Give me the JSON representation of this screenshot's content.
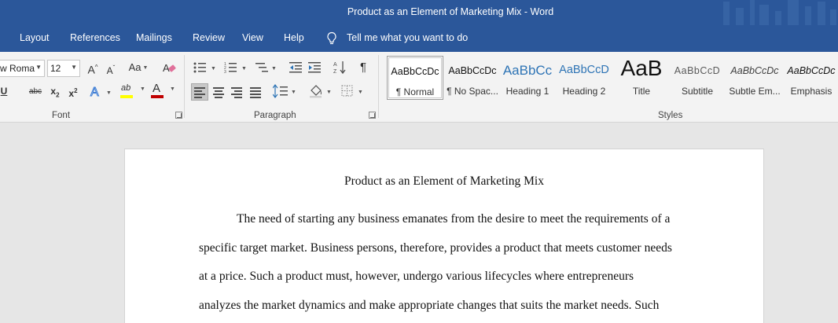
{
  "window": {
    "title": "Product as an Element of Marketing Mix  -  Word"
  },
  "menu": {
    "tabs": [
      "Layout",
      "References",
      "Mailings",
      "Review",
      "View",
      "Help"
    ],
    "tell_me": "Tell me what you want to do"
  },
  "ribbon": {
    "font": {
      "group_label": "Font",
      "font_name": "w Roma",
      "font_size": "12",
      "grow": "A",
      "shrink": "A",
      "change_case": "Aa",
      "strikethrough": "abc",
      "subscript": "x",
      "superscript": "x",
      "underline": "U",
      "highlight_label": "ab",
      "font_color_label": "A",
      "highlight_color": "#ffff00",
      "font_color": "#c00000"
    },
    "paragraph": {
      "group_label": "Paragraph",
      "pilcrow": "¶"
    },
    "styles": {
      "group_label": "Styles",
      "items": [
        {
          "sample": "AaBbCcDc",
          "name": "¶ Normal"
        },
        {
          "sample": "AaBbCcDc",
          "name": "¶ No Spac..."
        },
        {
          "sample": "AaBbCc",
          "name": "Heading 1"
        },
        {
          "sample": "AaBbCcD",
          "name": "Heading 2"
        },
        {
          "sample": "AaB",
          "name": "Title"
        },
        {
          "sample": "AaBbCcD",
          "name": "Subtitle"
        },
        {
          "sample": "AaBbCcDc",
          "name": "Subtle Em..."
        },
        {
          "sample": "AaBbCcDc",
          "name": "Emphasis"
        }
      ]
    }
  },
  "document": {
    "title": "Product as an Element of Marketing Mix",
    "lines": [
      "The need of starting any business emanates from the desire to meet the requirements of a",
      "specific target market. Business persons, therefore, provides a product that meets customer needs",
      "at a price. Such a product must, however, undergo various lifecycles where entrepreneurs",
      "analyzes the market dynamics and make appropriate changes that suits the market needs. Such"
    ]
  }
}
